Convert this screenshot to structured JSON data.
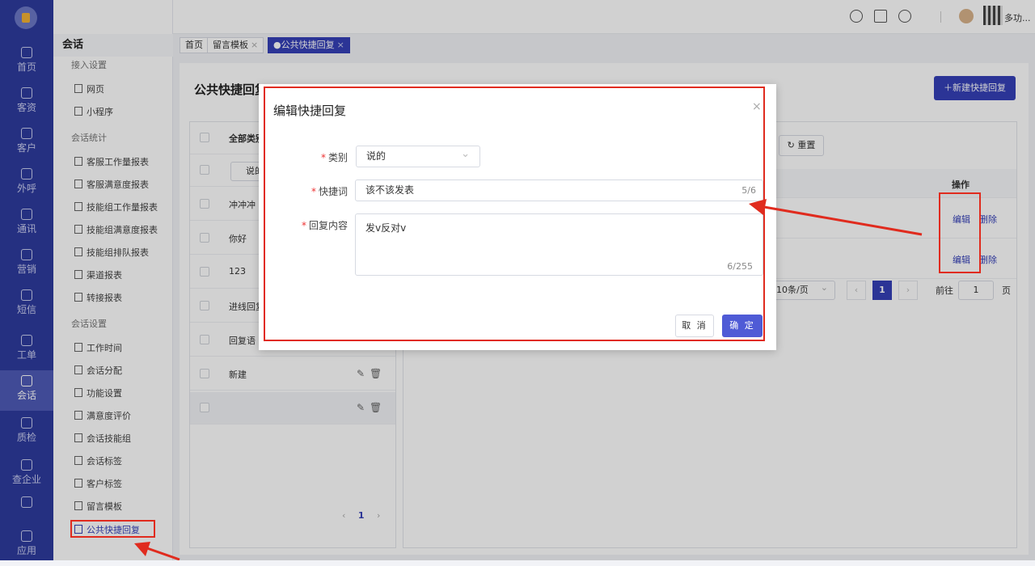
{
  "nav": {
    "items": [
      {
        "label": "首页",
        "icon": "home-icon"
      },
      {
        "label": "客资",
        "icon": "users-icon"
      },
      {
        "label": "客户",
        "icon": "user-icon"
      },
      {
        "label": "外呼",
        "icon": "phone-icon"
      },
      {
        "label": "通讯",
        "icon": "contacts-icon"
      },
      {
        "label": "营销",
        "icon": "gear-icon"
      },
      {
        "label": "短信",
        "icon": "message-icon"
      },
      {
        "label": "工单",
        "icon": "ticket-icon"
      },
      {
        "label": "会话",
        "icon": "chat-icon",
        "active": true
      },
      {
        "label": "质检",
        "icon": "quality-icon"
      },
      {
        "label": "查企业",
        "icon": "building-icon"
      },
      {
        "label": "",
        "icon": "list-icon"
      },
      {
        "label": "应用",
        "icon": "apps-icon"
      }
    ]
  },
  "sidebar": {
    "title": "会话",
    "groups": [
      "接入设置",
      "会话统计",
      "会话设置"
    ],
    "items": [
      "网页",
      "小程序",
      "客服工作量报表",
      "客服满意度报表",
      "技能组工作量报表",
      "技能组满意度报表",
      "技能组排队报表",
      "渠道报表",
      "转接报表",
      "工作时间",
      "会话分配",
      "功能设置",
      "满意度评价",
      "会话技能组",
      "会话标签",
      "客户标签",
      "留言模板",
      "公共快捷回复"
    ]
  },
  "topbar": {
    "username": "多功...",
    "icons": [
      "headset-icon",
      "book-icon",
      "chat-bubble-icon"
    ]
  },
  "tabs": [
    {
      "label": "首页",
      "closable": false
    },
    {
      "label": "留言模板",
      "closable": true
    },
    {
      "label": "●公共快捷回复",
      "closable": true,
      "active": true
    }
  ],
  "page": {
    "title": "公共快捷回复",
    "new_button": "＋新建快捷回复",
    "left_header": "全部类别",
    "filter_value": "说的",
    "category_rows": [
      "冲冲冲",
      "你好",
      "123",
      "进线回复",
      "回复语",
      "新建",
      ""
    ],
    "reset_button": "↻ 重置",
    "ops_header": "操作",
    "edit_label": "编辑",
    "delete_label": "删除",
    "left_pager_page": "1",
    "pagination": {
      "page_size": "10条/页",
      "current": "1",
      "goto_label": "前往",
      "goto_value": "1",
      "page_unit": "页"
    }
  },
  "dialog": {
    "title": "编辑快捷回复",
    "close": "×",
    "category_label": "类别",
    "category_value": "说的",
    "keyword_label": "快捷词",
    "keyword_value": "该不该发表",
    "keyword_count": "5/6",
    "content_label": "回复内容",
    "content_value": "发v反对v",
    "content_count": "6/255",
    "cancel": "取 消",
    "confirm": "确 定"
  },
  "annotation_colors": {
    "highlight": "#e02b1e",
    "primary": "#3540b8"
  }
}
